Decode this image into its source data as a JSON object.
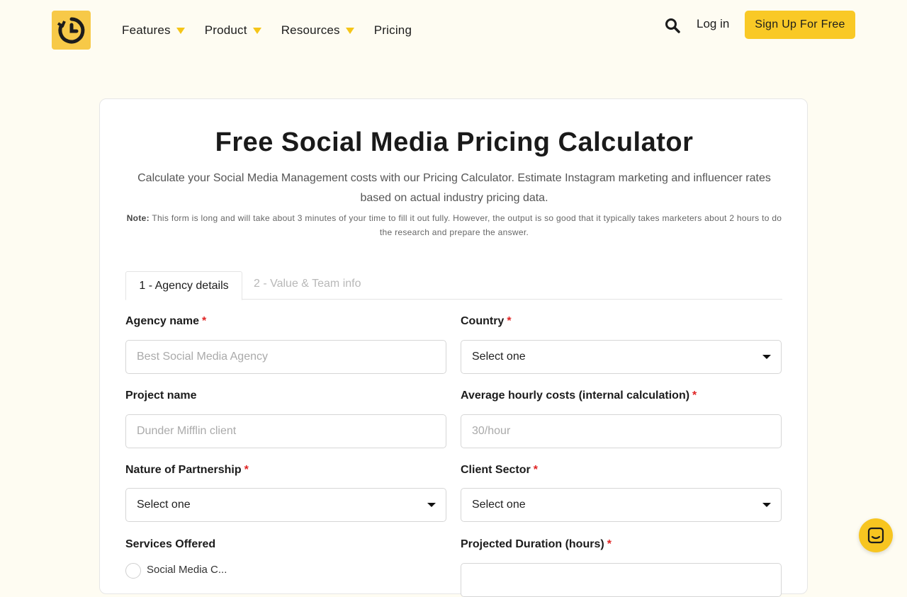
{
  "header": {
    "nav": [
      {
        "label": "Features"
      },
      {
        "label": "Product"
      },
      {
        "label": "Resources"
      },
      {
        "label": "Pricing"
      }
    ],
    "login_label": "Log in",
    "signup_label": "Sign Up For Free"
  },
  "card": {
    "title": "Free Social Media Pricing Calculator",
    "subtitle": "Calculate your Social Media Management costs with our Pricing Calculator. Estimate Instagram marketing and influencer rates based on actual industry pricing data.",
    "note_prefix": "Note:",
    "note_text": "This form is long and will take about 3 minutes of your time to fill it out fully. However, the output is so good that it typically takes marketers about 2 hours to do the research and prepare the answer.",
    "tabs": [
      {
        "label": "1 - Agency details"
      },
      {
        "label": "2 - Value & Team info"
      }
    ]
  },
  "form": {
    "agency_name": {
      "label": "Agency name",
      "required": "*",
      "placeholder": "Best Social Media Agency"
    },
    "country": {
      "label": "Country",
      "required": "*",
      "value": "Select one"
    },
    "project_name": {
      "label": "Project name",
      "placeholder": "Dunder Mifflin client"
    },
    "hourly_costs": {
      "label": "Average hourly costs (internal calculation)",
      "required": "*",
      "placeholder": "30/hour"
    },
    "partnership": {
      "label": "Nature of Partnership",
      "required": "*",
      "value": "Select one"
    },
    "client_sector": {
      "label": "Client Sector",
      "required": "*",
      "value": "Select one"
    },
    "services": {
      "label": "Services Offered",
      "first_option": "Social Media C..."
    },
    "duration": {
      "label": "Projected Duration (hours)",
      "required": "*"
    }
  },
  "colors": {
    "accent": "#f9c926",
    "background": "#fefcf2",
    "required": "#e02424"
  },
  "icons": {
    "logo": "clock-history-icon",
    "search": "search-icon",
    "chat": "chat-icon"
  }
}
